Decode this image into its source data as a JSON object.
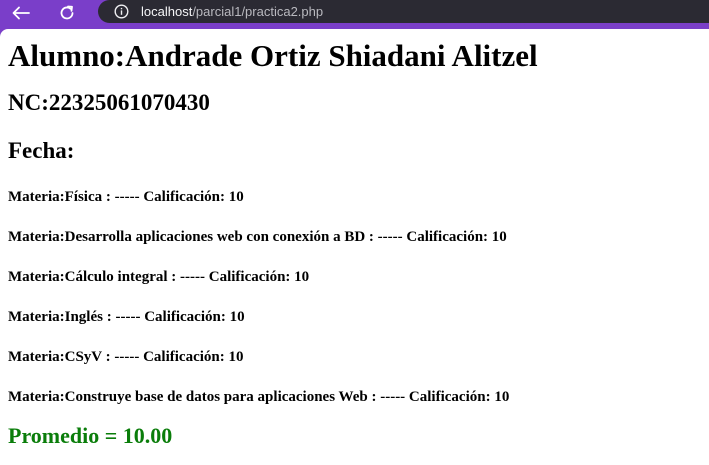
{
  "browser": {
    "url_host": "localhost",
    "url_path": "/parcial1/practica2.php"
  },
  "page": {
    "student_label": "Alumno:Andrade Ortiz Shiadani Alitzel",
    "nc_label": "NC:22325061070430",
    "date_label": "Fecha:",
    "subjects": [
      "Materia:Física : ----- Calificación: 10",
      "Materia:Desarrolla aplicaciones web con conexión a BD : ----- Calificación: 10",
      "Materia:Cálculo integral : ----- Calificación: 10",
      "Materia:Inglés : ----- Calificación: 10",
      "Materia:CSyV : ----- Calificación: 10",
      "Materia:Construye base de datos para aplicaciones Web : ----- Calificación: 10"
    ],
    "average_label": "Promedio = 10.00"
  },
  "colors": {
    "browser_accent": "#7b3fc8",
    "address_bar": "#2b2a33",
    "average_text": "#0a7d0a"
  },
  "icons": {
    "back": "arrow-left-icon",
    "reload": "reload-icon",
    "info": "info-icon"
  }
}
